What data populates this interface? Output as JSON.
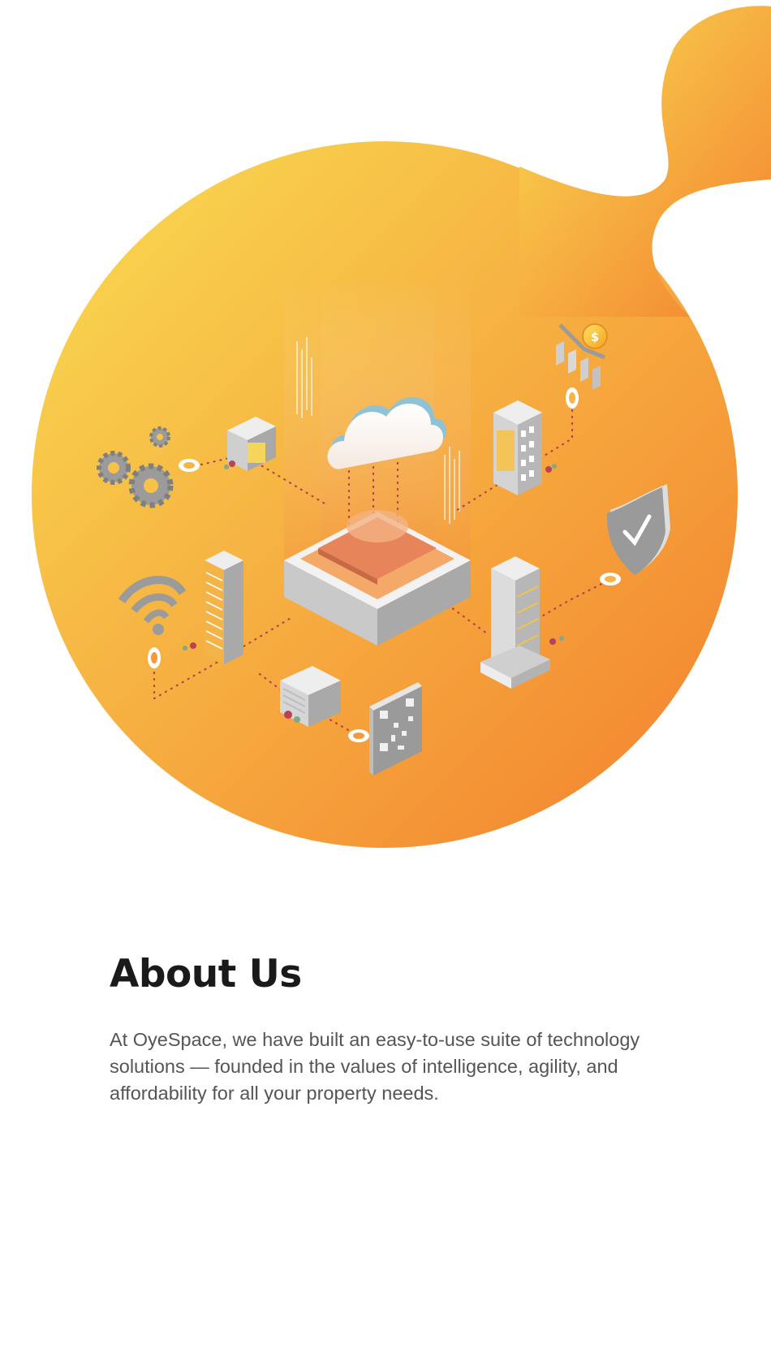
{
  "hero": {
    "gradient_start": "#f9dd52",
    "gradient_end": "#f37f2e",
    "illustration_icons": [
      "gears-icon",
      "office-building-icon",
      "cloud-icon",
      "server-platform-icon",
      "finance-chart-icon",
      "tower-building-icon",
      "shield-check-icon",
      "wifi-icon",
      "skyscraper-icon",
      "store-building-icon",
      "qr-code-icon",
      "high-rise-icon"
    ]
  },
  "about": {
    "title": "About Us",
    "text": "At OyeSpace, we have built an easy-to-use suite of technology\nsolutions — founded in the values of intelligence, agility, and\naffordability for all your  property needs.",
    "title_color": "#1a1a1a",
    "text_color": "#555555"
  }
}
